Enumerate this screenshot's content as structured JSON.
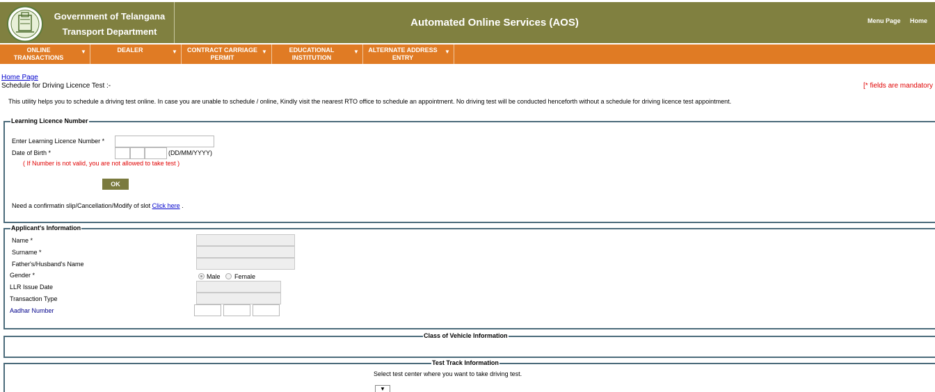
{
  "header": {
    "gov_line1": "Government of Telangana",
    "gov_line2": "Transport Department",
    "app_title": "Automated Online Services (AOS)",
    "menu_page_link": "Menu Page",
    "home_link": "Home",
    "bar_color": "#808040"
  },
  "menu": {
    "accent_color": "#e07b24",
    "items": [
      {
        "line1": "ONLINE",
        "line2": "TRANSACTIONS",
        "icon": "chevron-down-icon"
      },
      {
        "line1": "DEALER",
        "line2": "",
        "icon": "chevron-down-icon"
      },
      {
        "line1": "CONTRACT CARRIAGE",
        "line2": "PERMIT",
        "icon": "chevron-down-icon"
      },
      {
        "line1": "EDUCATIONAL",
        "line2": "INSTITUTION",
        "icon": "chevron-down-icon"
      },
      {
        "line1": "ALTERNATE ADDRESS",
        "line2": "ENTRY",
        "icon": "chevron-down-icon"
      }
    ]
  },
  "page": {
    "breadcrumb": "Home Page",
    "heading": "Schedule for Driving Licence Test :-",
    "mandatory_note": "[* fields are mandatory",
    "intro": "This utility helps you to schedule a driving test online. In case you are unable to schedule /  online, Kindly visit the nearest RTO office to schedule an appointment. No driving test will be conducted henceforth without a schedule for driving licence test appointment."
  },
  "ll_section": {
    "legend": "Learning Licence Number",
    "ll_number_label": "Enter Learning Licence Number *",
    "dob_label": "Date of Birth *",
    "dob_format": "(DD/MM/YYYY)",
    "warning": "( If Number is not valid, you are not allowed to take test )",
    "ok_label": "OK",
    "slip_text": "Need a confirmatin slip/Cancellation/Modify of slot ",
    "click_here": "Click here",
    "slip_end": " ."
  },
  "applicant": {
    "legend": "Applicant's Information",
    "name_label": "Name *",
    "surname_label": "Surname *",
    "father_label": "Father's/Husband's Name",
    "gender_label": "Gender *",
    "male_label": "Male",
    "female_label": "Female",
    "llr_label": "LLR Issue Date",
    "txn_label": "Transaction Type",
    "aadhar_label": "Aadhar Number"
  },
  "vehicle": {
    "legend": "Class of Vehicle Information"
  },
  "track": {
    "legend": "Test Track Information",
    "instruction": "Select test center where you want to take driving test.",
    "select_icon": "dropdown-arrow-icon"
  }
}
